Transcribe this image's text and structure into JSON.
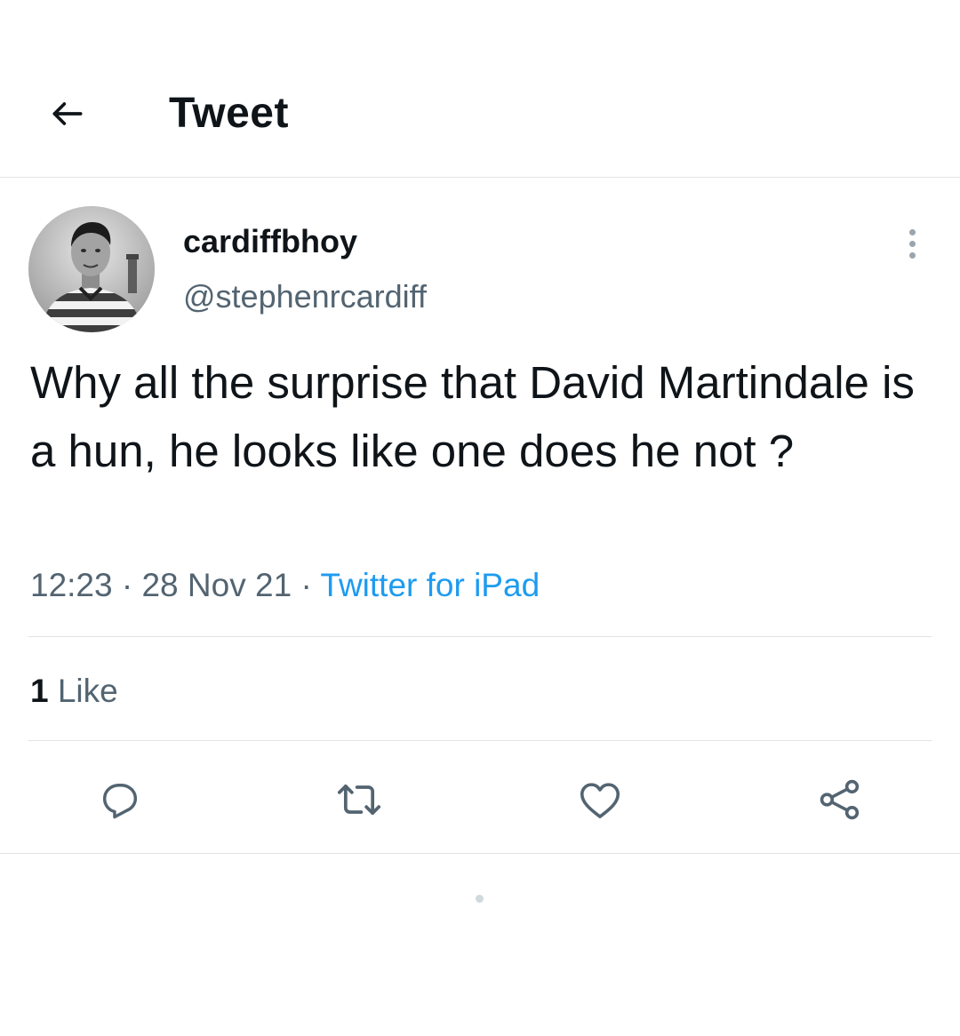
{
  "header": {
    "back_icon": "arrow-left-icon",
    "title": "Tweet"
  },
  "author": {
    "display_name": "cardiffbhoy",
    "handle": "@stephenrcardiff",
    "more_icon": "more-vertical-icon"
  },
  "tweet": {
    "text": "Why all the surprise that David Martindale is a hun, he looks like one does he not ?",
    "time": "12:23",
    "date": "28 Nov 21",
    "separator": "·",
    "source": "Twitter for iPad"
  },
  "stats": {
    "likes_count": "1",
    "likes_label": "Like"
  },
  "actions": [
    {
      "name": "reply",
      "icon": "reply-icon"
    },
    {
      "name": "retweet",
      "icon": "retweet-icon"
    },
    {
      "name": "like",
      "icon": "heart-icon"
    },
    {
      "name": "share",
      "icon": "share-icon"
    }
  ],
  "colors": {
    "text": "#0f1419",
    "secondary": "#536471",
    "link": "#1d9bf0",
    "divider": "#e1e4e6",
    "icon": "#536471"
  }
}
